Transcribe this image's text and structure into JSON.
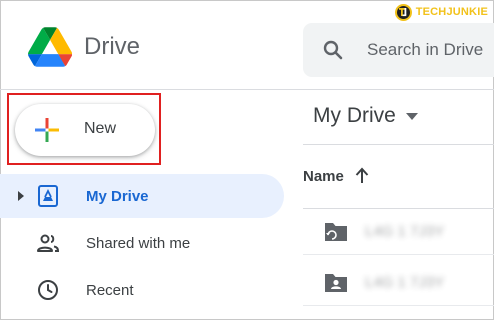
{
  "watermark": {
    "mark": "TJ",
    "brand": "TECHJUNKIE"
  },
  "header": {
    "app_name": "Drive",
    "search_placeholder": "Search in Drive"
  },
  "new_button": {
    "label": "New"
  },
  "sidebar": {
    "items": [
      {
        "label": "My Drive",
        "icon": "my-drive-icon",
        "active": true
      },
      {
        "label": "Shared with me",
        "icon": "people-icon",
        "active": false
      },
      {
        "label": "Recent",
        "icon": "clock-icon",
        "active": false
      }
    ]
  },
  "main": {
    "title": "My Drive",
    "column_name": "Name",
    "rows": [
      {
        "name": "L4G 1 7J3Y",
        "icon": "shared-folder-icon"
      },
      {
        "name": "L4G 1 7J3Y",
        "icon": "person-folder-icon"
      }
    ]
  },
  "colors": {
    "accent": "#1967d2",
    "active_bg": "#e8f0fe",
    "highlight": "#e02020",
    "text": "#3c4043"
  }
}
